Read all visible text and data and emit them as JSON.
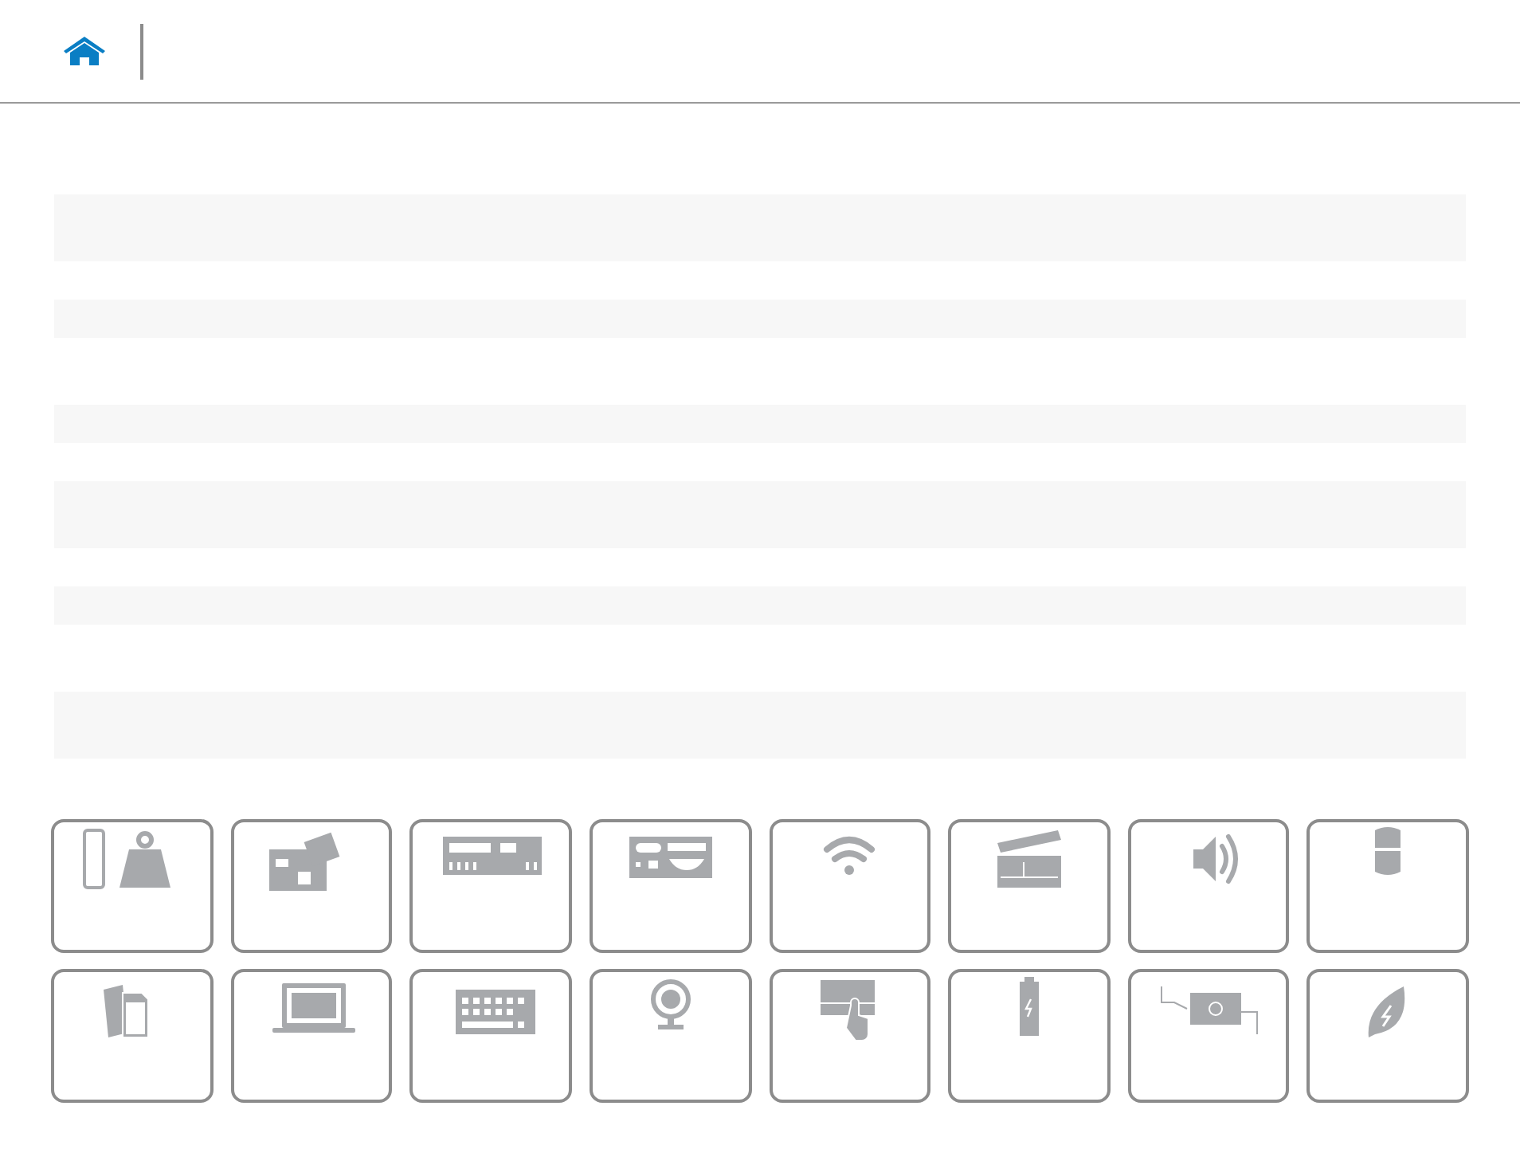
{
  "header": {
    "home": {
      "kind": "home"
    }
  },
  "table": {
    "rows": [
      {
        "kind": "tall"
      },
      {
        "kind": "short"
      },
      {
        "kind": "short"
      },
      {
        "kind": "tall"
      },
      {
        "kind": "short"
      },
      {
        "kind": "short"
      },
      {
        "kind": "tall"
      },
      {
        "kind": "short"
      },
      {
        "kind": "short"
      },
      {
        "kind": "tall"
      },
      {
        "kind": "tall"
      }
    ]
  },
  "tiles": [
    {
      "kind": "dimensions-weight"
    },
    {
      "kind": "system-board"
    },
    {
      "kind": "back-ports"
    },
    {
      "kind": "side-ports"
    },
    {
      "kind": "wireless"
    },
    {
      "kind": "media"
    },
    {
      "kind": "audio"
    },
    {
      "kind": "storage"
    },
    {
      "kind": "memory-card"
    },
    {
      "kind": "display"
    },
    {
      "kind": "keyboard"
    },
    {
      "kind": "camera"
    },
    {
      "kind": "touchpad"
    },
    {
      "kind": "battery"
    },
    {
      "kind": "power-adapter"
    },
    {
      "kind": "energy"
    }
  ]
}
